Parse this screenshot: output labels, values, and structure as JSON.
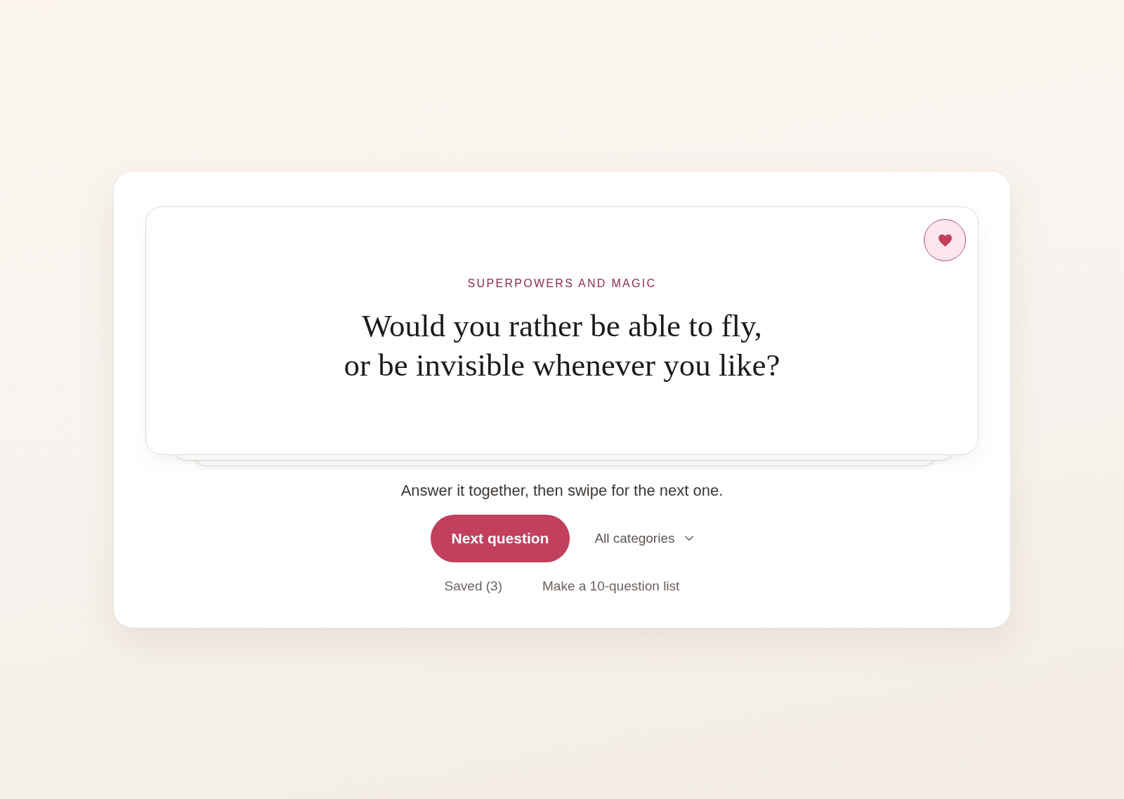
{
  "question_card": {
    "category": "SUPERPOWERS AND MAGIC",
    "question": "Would you rather be able to fly,\nor be invisible whenever you like?",
    "favorite": {
      "selected": true
    }
  },
  "hint": "Answer it together, then swipe for the next one.",
  "primary_button": "Next question",
  "category_filter": {
    "label": "All categories"
  },
  "links": [
    "Saved (3)",
    "Make a 10-question list"
  ]
}
